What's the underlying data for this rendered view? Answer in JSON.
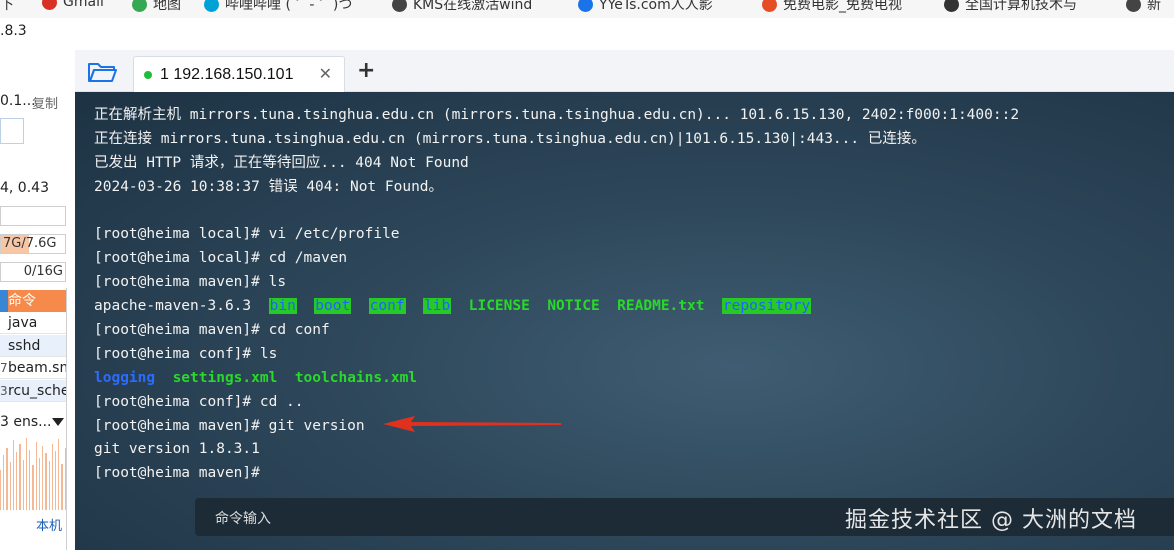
{
  "bookmarks": [
    {
      "label": "下",
      "icon": "",
      "color": "#ffffff"
    },
    {
      "label": "Gmail",
      "icon": "gmail-icon",
      "color": "#d93025"
    },
    {
      "label": "地图",
      "icon": "maps-icon",
      "color": "#34a853"
    },
    {
      "label": "哔哩哔哩 ( ゜- ゜)つ",
      "icon": "bilibili-icon",
      "color": "#00a1d6"
    },
    {
      "label": "KMS在线激活wind",
      "icon": "kms-icon",
      "color": "#444444"
    },
    {
      "label": "YYeTs.com人人影",
      "icon": "yyets-icon",
      "color": "#1a73e8"
    },
    {
      "label": "免费电影_免费电视",
      "icon": "movie-icon",
      "color": "#e44d26"
    },
    {
      "label": "全国计算机技术与",
      "icon": "exam-icon",
      "color": "#333333"
    },
    {
      "label": "新",
      "icon": "news-icon",
      "color": "#444444"
    }
  ],
  "left_panel": {
    "version": ".8.3",
    "ip_partial": "0.1...",
    "copy_label": "复制",
    "load": "4, 0.43",
    "memory": "7G/7.6G",
    "swap": "0/16G",
    "command_header": "命令",
    "processes": [
      {
        "num": "",
        "name": "java"
      },
      {
        "num": "",
        "name": "sshd"
      },
      {
        "num": "7",
        "name": "beam.sm"
      },
      {
        "num": "3",
        "name": "rcu_sche"
      }
    ],
    "interface": "3 ens...",
    "local_label": "本机"
  },
  "tabs": [
    {
      "label": "1 192.168.150.101",
      "status_color": "#1fbe3a"
    }
  ],
  "terminal": {
    "lines": [
      [
        {
          "t": "正在解析主机 mirrors.tuna.tsinghua.edu.cn (mirrors.tuna.tsinghua.edu.cn)... 101.6.15.130, 2402:f000:1:400::2",
          "c": ""
        }
      ],
      [
        {
          "t": "正在连接 mirrors.tuna.tsinghua.edu.cn (mirrors.tuna.tsinghua.edu.cn)|101.6.15.130|:443... 已连接。",
          "c": ""
        }
      ],
      [
        {
          "t": "已发出 HTTP 请求，正在等待回应... 404 Not Found",
          "c": ""
        }
      ],
      [
        {
          "t": "2024-03-26 10:38:37 错误 404: Not Found。",
          "c": ""
        }
      ],
      [
        {
          "t": "",
          "c": ""
        }
      ],
      [
        {
          "t": "[root@heima local]# vi /etc/profile",
          "c": ""
        }
      ],
      [
        {
          "t": "[root@heima local]# cd /maven",
          "c": ""
        }
      ],
      [
        {
          "t": "[root@heima maven]# ls",
          "c": ""
        }
      ],
      [
        {
          "t": "apache-maven-3.6.3  ",
          "c": ""
        },
        {
          "t": "bin",
          "c": "hl"
        },
        {
          "t": "  ",
          "c": ""
        },
        {
          "t": "boot",
          "c": "hl"
        },
        {
          "t": "  ",
          "c": ""
        },
        {
          "t": "conf",
          "c": "hl"
        },
        {
          "t": "  ",
          "c": ""
        },
        {
          "t": "lib",
          "c": "hl"
        },
        {
          "t": "  ",
          "c": ""
        },
        {
          "t": "LICENSE",
          "c": "hl-green"
        },
        {
          "t": "  ",
          "c": ""
        },
        {
          "t": "NOTICE",
          "c": "hl-green"
        },
        {
          "t": "  ",
          "c": ""
        },
        {
          "t": "README.txt",
          "c": "hl-green"
        },
        {
          "t": "  ",
          "c": ""
        },
        {
          "t": "repository",
          "c": "hl"
        }
      ],
      [
        {
          "t": "[root@heima maven]# cd conf",
          "c": ""
        }
      ],
      [
        {
          "t": "[root@heima conf]# ls",
          "c": ""
        }
      ],
      [
        {
          "t": "logging",
          "c": "dir-blue"
        },
        {
          "t": "  ",
          "c": ""
        },
        {
          "t": "settings.xml",
          "c": "hl-green"
        },
        {
          "t": "  ",
          "c": ""
        },
        {
          "t": "toolchains.xml",
          "c": "hl-green"
        }
      ],
      [
        {
          "t": "[root@heima conf]# cd ..",
          "c": ""
        }
      ],
      [
        {
          "t": "[root@heima maven]# git version",
          "c": ""
        }
      ],
      [
        {
          "t": "git version 1.8.3.1",
          "c": ""
        }
      ],
      [
        {
          "t": "[root@heima maven]#",
          "c": ""
        }
      ]
    ]
  },
  "command_bar": {
    "placeholder": "命令输入"
  },
  "watermark": "掘金技术社区 @ 大洲的文档",
  "colors": {
    "arrow": "#e0301e",
    "terminal_bg": "#2d4659"
  }
}
